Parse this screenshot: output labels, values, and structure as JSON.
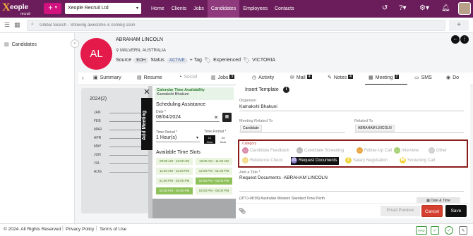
{
  "logo": {
    "mark": "X",
    "name": "eople",
    "sub": "recruit"
  },
  "topbar": {
    "add_label": "+",
    "company": "Xeople Recruit Ltd",
    "nav": [
      "Home",
      "Clients",
      "Jobs",
      "Candidates",
      "Employees",
      "Contacts"
    ],
    "active_nav": "Candidates",
    "icons": [
      "history-icon",
      "help-icon",
      "settings-icon",
      "bell-icon"
    ]
  },
  "search": {
    "placeholder": "Global Search - Showing awesome is coming soon",
    "add_label": "+"
  },
  "sidebar": {
    "items": [
      {
        "label": "Candidates",
        "icon": "candidates-icon"
      }
    ]
  },
  "candidate": {
    "initials": "AL",
    "name": "ABRAHAM LINCOLN",
    "location": "MALVERN, AUSTRALIA",
    "source_label": "Source",
    "source_value": "EOH",
    "status_label": "Status",
    "status_value": "ACTIVE",
    "tag_label": "+ Tag",
    "experienced_label": "Experienced",
    "city_label": "VICTORIA"
  },
  "tabs": [
    {
      "label": "Summary",
      "icon": "summary-icon",
      "count": ""
    },
    {
      "label": "Resume",
      "icon": "resume-icon",
      "count": ""
    },
    {
      "label": "Social",
      "icon": "social-icon",
      "count": ""
    },
    {
      "label": "Jobs",
      "icon": "jobs-icon",
      "count": "3"
    },
    {
      "label": "Activity",
      "icon": "activity-icon",
      "count": ""
    },
    {
      "label": "Mail",
      "icon": "mail-icon",
      "count": "4"
    },
    {
      "label": "Notes",
      "icon": "notes-icon",
      "count": "4"
    },
    {
      "label": "Meeting",
      "icon": "meeting-icon",
      "count": "2"
    },
    {
      "label": "SMS",
      "icon": "sms-icon",
      "count": ""
    },
    {
      "label": "Do",
      "icon": "docs-icon",
      "count": ""
    }
  ],
  "active_tab": "Meeting",
  "timeline": {
    "year": "2024(2)",
    "months": [
      "JAN",
      "FEB",
      "MAR",
      "APR",
      "MAY",
      "JUN",
      "JUL",
      "AUG"
    ]
  },
  "add_meeting_label": "Add Meeting",
  "scheduling": {
    "calendar_title": "Calendar Time Availability",
    "calendar_owner": "Kamakshi Bhakuni",
    "title": "Scheduling Assistance",
    "date_label": "Date *",
    "date_value": "08/04/2024",
    "time_period_label": "Time Period *",
    "time_period_value": "1 Hour(s)",
    "time_format_label": "Time Format *",
    "format_12_top": "12",
    "format_12_bottom": "Hour",
    "format_24_top": "24",
    "format_24_bottom": "Hour",
    "available_title": "Available Time Slots",
    "slots": [
      {
        "label": "09:00 AM - 10:00 AM",
        "selected": false
      },
      {
        "label": "10:00 AM - 11:00 AM",
        "selected": false
      },
      {
        "label": "11:00 AM - 12:00 PM",
        "selected": false
      },
      {
        "label": "12:00 PM - 01:00 PM",
        "selected": false
      },
      {
        "label": "01:00 PM - 02:00 PM",
        "selected": false
      },
      {
        "label": "02:00 PM - 03:00 PM",
        "selected": true
      },
      {
        "label": "03:00 PM - 04:00 PM",
        "selected": true
      },
      {
        "label": "04:00 PM - 05:00 PM",
        "selected": false
      }
    ]
  },
  "meeting": {
    "insert_template": "Insert Template",
    "organiser_label": "Organiser",
    "organiser_value": "Kamakshi Bhakuni",
    "related_to_meeting_label": "Meeting Related To",
    "related_to_meeting_value": "Candidate",
    "related_to_label": "Related To",
    "related_to_value": "ABRAHAM LINCOLN",
    "category_label": "Category",
    "categories": [
      {
        "label": "Candidate Feedback",
        "icon": "feedback-icon",
        "color": "#d88aa8",
        "selected": false
      },
      {
        "label": "Candidate Screening",
        "icon": "screening-icon",
        "color": "#b9b9b9",
        "selected": false
      },
      {
        "label": "Follow-Up Call",
        "icon": "followup-icon",
        "color": "#e8a33b",
        "selected": false
      },
      {
        "label": "Interview",
        "icon": "interview-icon",
        "color": "#a3cf6f",
        "selected": false
      },
      {
        "label": "Other",
        "icon": "other-icon",
        "color": "#cfcfcf",
        "selected": false
      },
      {
        "label": "Reference Check",
        "icon": "reference-icon",
        "color": "#f2d98a",
        "selected": false
      },
      {
        "label": "Request Documents",
        "icon": "documents-icon",
        "color": "#8a7bc8",
        "selected": true
      },
      {
        "label": "Salary Negotiation",
        "icon": "salary-icon",
        "color": "#f0d33a",
        "selected": false
      },
      {
        "label": "Screening Call",
        "icon": "call-icon",
        "color": "#f5d23c",
        "selected": false
      }
    ],
    "title_label": "Add a Title *",
    "title_value": "Request Documents -ABRAHAM LINCOLN",
    "timezone": "(UTC+08:00) Australian Western Standard Time/ Perth",
    "date_time_label": "Date & Time",
    "email_preview": "Email Preview",
    "cancel": "Cancel",
    "save": "Save"
  },
  "footer": {
    "copyright": "© 2024. All Rights Reserved",
    "privacy": "Privacy Policy",
    "terms": "Terms of Use",
    "badge": "PPD"
  },
  "colors": {
    "topbar": "#6b1d5b",
    "accent_pink": "#d2127e",
    "avatar": "#e31a4a",
    "cancel": "#d43f2f"
  }
}
